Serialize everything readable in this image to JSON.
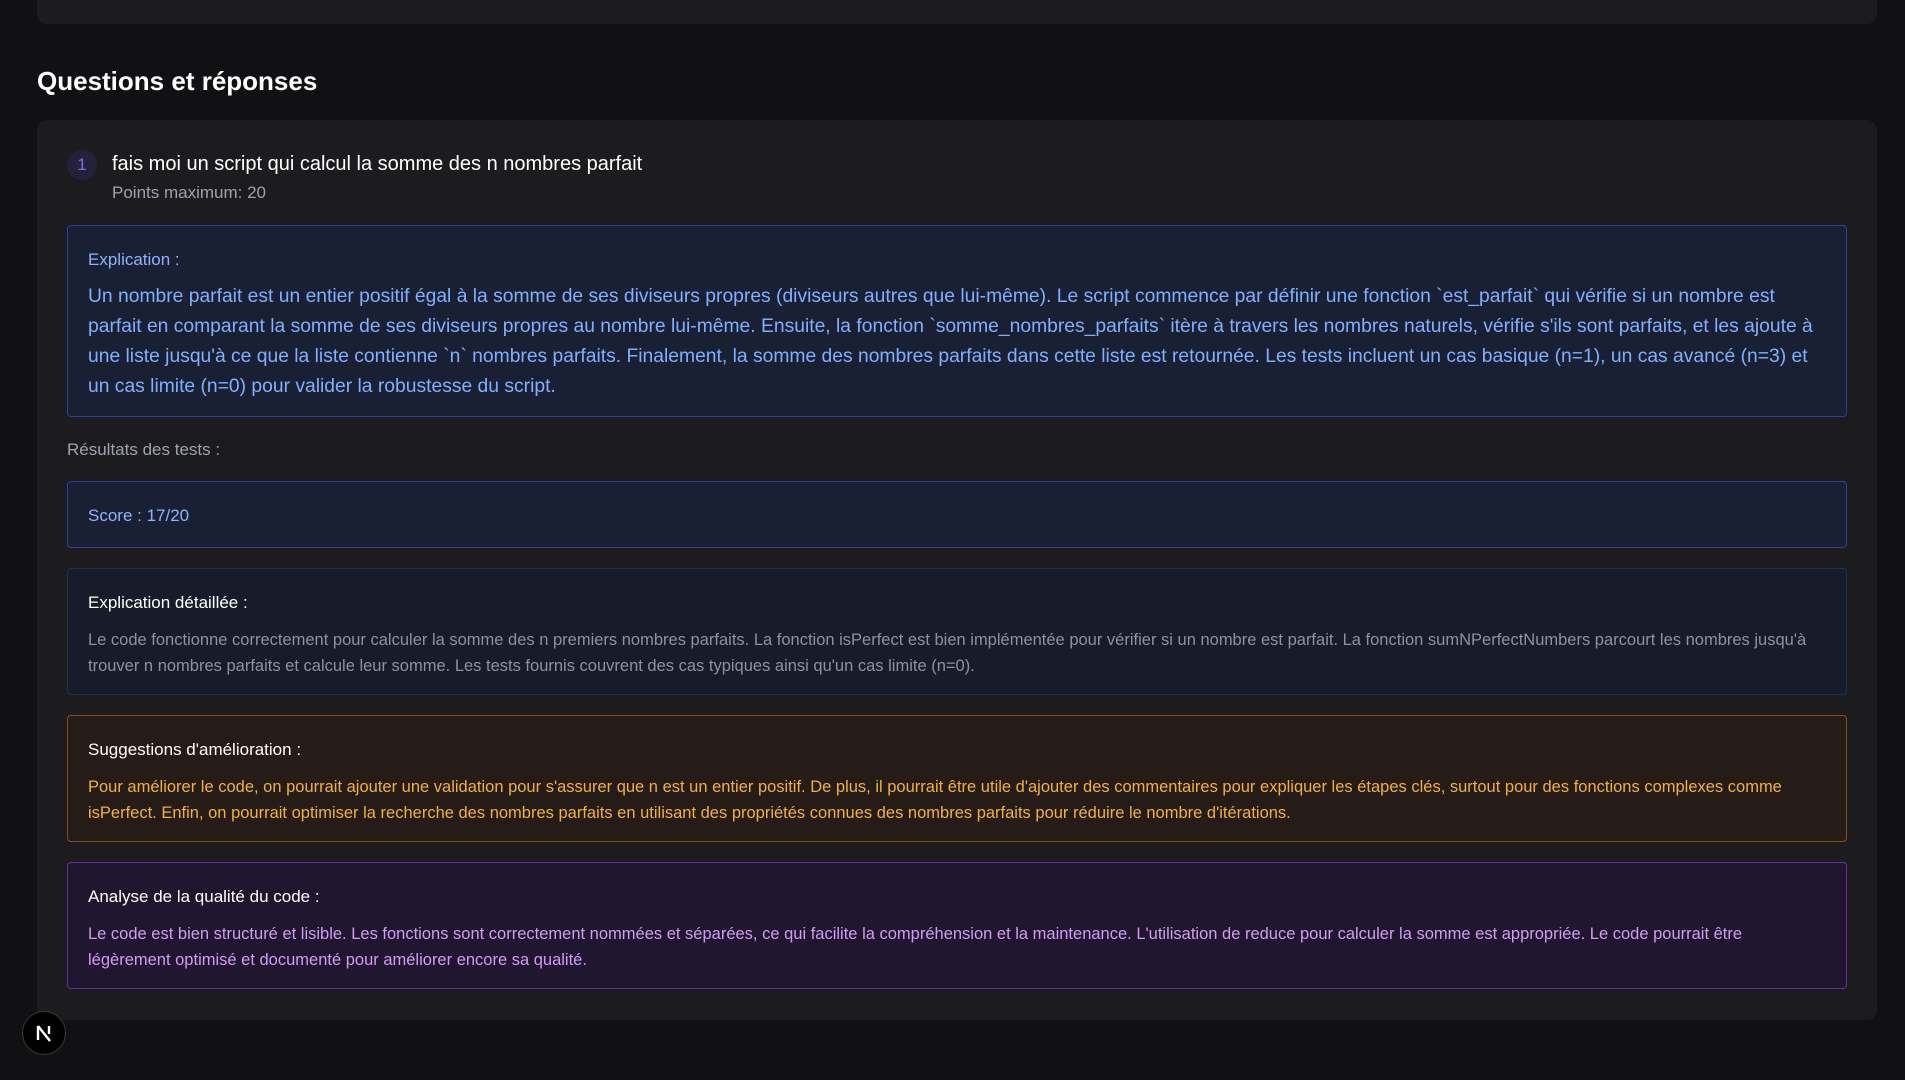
{
  "section": {
    "title": "Questions et réponses"
  },
  "question": {
    "number": "1",
    "text": "fais moi un script qui calcul la somme des n nombres parfait",
    "max_points": "Points maximum: 20",
    "explanation": {
      "label": "Explication :",
      "body": "Un nombre parfait est un entier positif égal à la somme de ses diviseurs propres (diviseurs autres que lui-même). Le script commence par définir une fonction `est_parfait` qui vérifie si un nombre est parfait en comparant la somme de ses diviseurs propres au nombre lui-même. Ensuite, la fonction `somme_nombres_parfaits` itère à travers les nombres naturels, vérifie s'ils sont parfaits, et les ajoute à une liste jusqu'à ce que la liste contienne `n` nombres parfaits. Finalement, la somme des nombres parfaits dans cette liste est retournée. Les tests incluent un cas basique (n=1), un cas avancé (n=3) et un cas limite (n=0) pour valider la robustesse du script."
    }
  },
  "results": {
    "label": "Résultats des tests :",
    "score": "Score : 17/20",
    "detail": {
      "label": "Explication détaillée :",
      "body": "Le code fonctionne correctement pour calculer la somme des n premiers nombres parfaits. La fonction isPerfect est bien implémentée pour vérifier si un nombre est parfait. La fonction sumNPerfectNumbers parcourt les nombres jusqu'à trouver n nombres parfaits et calcule leur somme. Les tests fournis couvrent des cas typiques ainsi qu'un cas limite (n=0)."
    },
    "suggestions": {
      "label": "Suggestions d'amélioration :",
      "body": "Pour améliorer le code, on pourrait ajouter une validation pour s'assurer que n est un entier positif. De plus, il pourrait être utile d'ajouter des commentaires pour expliquer les étapes clés, surtout pour des fonctions complexes comme isPerfect. Enfin, on pourrait optimiser la recherche des nombres parfaits en utilisant des propriétés connues des nombres parfaits pour réduire le nombre d'itérations."
    },
    "quality": {
      "label": "Analyse de la qualité du code :",
      "body": "Le code est bien structuré et lisible. Les fonctions sont correctement nommées et séparées, ce qui facilite la compréhension et la maintenance. L'utilisation de reduce pour calculer la somme est appropriée. Le code pourrait être légèrement optimisé et documenté pour améliorer encore sa qualité."
    }
  },
  "dev_badge": {
    "icon": "nextjs-logo-icon"
  },
  "colors": {
    "background": "#111114",
    "card": "#1c1c1f",
    "info_blue": "#7fb0ff",
    "warning_orange": "#f3b13b",
    "quality_purple": "#d39bf6"
  }
}
